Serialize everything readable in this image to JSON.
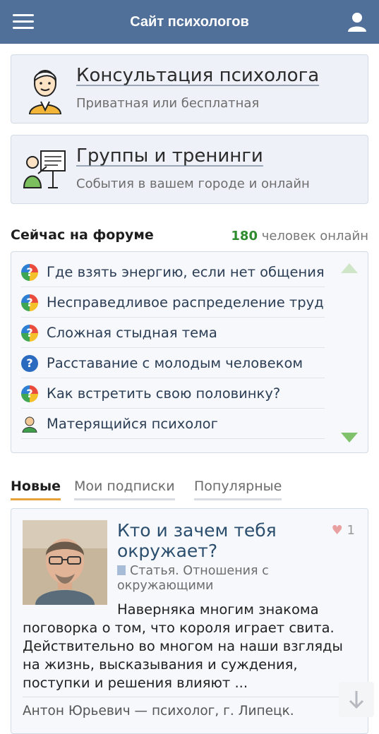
{
  "header": {
    "title": "Сайт психологов",
    "menu_icon": "hamburger-menu-icon",
    "user_icon": "user-icon",
    "color": "#50709a"
  },
  "cards": [
    {
      "title": "Консультация психолога",
      "subtitle": "Приватная или бесплатная",
      "icon": "psychologist-illustration"
    },
    {
      "title": "Группы и тренинги",
      "subtitle": "События в вашем городе и онлайн",
      "icon": "trainer-illustration"
    }
  ],
  "forum": {
    "title": "Сейчас на форуме",
    "online_count": "180",
    "online_label": "человек онлайн",
    "items": [
      {
        "text": "Где взять энергию, если нет общения",
        "icon": "multicolor-question-icon"
      },
      {
        "text": "Несправедливое распределение труда",
        "icon": "multicolor-question-icon"
      },
      {
        "text": "Сложная стыдная тема",
        "icon": "multicolor-question-icon"
      },
      {
        "text": "Расставание с молодым человеком",
        "icon": "blue-question-icon"
      },
      {
        "text": "Как встретить свою половинку?",
        "icon": "multicolor-question-icon"
      },
      {
        "text": "Матерящийся психолог",
        "icon": "person-icon"
      }
    ]
  },
  "tabs": [
    {
      "label": "Новые",
      "active": true
    },
    {
      "label": "Мои подписки",
      "active": false
    },
    {
      "label": "Популярные",
      "active": false
    }
  ],
  "article": {
    "title": "Кто и зачем тебя окружает?",
    "likes": "1",
    "meta": "Статья. Отношения с окружающими",
    "excerpt_first": "Наверняка многим знакома",
    "excerpt_rest": "поговорка о том, что короля играет свита. Действительно во многом на наши взгляды на жизнь, высказывания и суждения, поступки и решения влияют ...",
    "author": "Антон Юрьевич — психолог, г. Липецк."
  }
}
